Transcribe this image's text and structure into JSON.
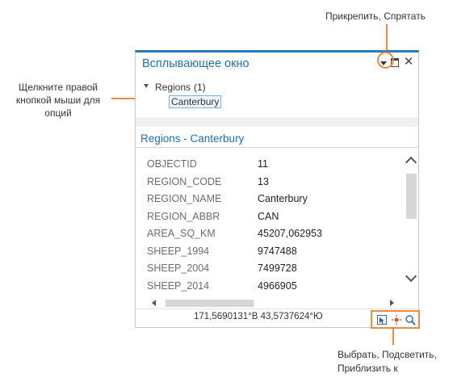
{
  "callouts": {
    "pin_hide": "Прикрепить, Спрятать",
    "right_click_lines": [
      "Щелкните правой",
      "кнопкой мыши для",
      "опций"
    ],
    "tools_lines": [
      "Выбрать, Подсветить,",
      "Приблизить к"
    ]
  },
  "popup": {
    "title": "Всплывающее окно",
    "controls": {
      "dropdown_icon": "chevron-down-icon",
      "maximize_icon": "maximize-icon",
      "close_glyph": "✕"
    },
    "tree": {
      "layer_label": "Regions",
      "layer_count": "(1)",
      "feature_label": "Canterbury"
    },
    "section_title": "Regions - Canterbury",
    "attributes": [
      {
        "key": "OBJECTID",
        "value": "11"
      },
      {
        "key": "REGION_CODE",
        "value": "13"
      },
      {
        "key": "REGION_NAME",
        "value": "Canterbury"
      },
      {
        "key": "REGION_ABBR",
        "value": "CAN"
      },
      {
        "key": "AREA_SQ_KM",
        "value": "45207,062953"
      },
      {
        "key": "SHEEP_1994",
        "value": "9747488"
      },
      {
        "key": "SHEEP_2004",
        "value": "7499728"
      },
      {
        "key": "SHEEP_2014",
        "value": "4966905"
      }
    ],
    "status_bar": {
      "coordinates": "171,5690131°В 43,5737624°Ю",
      "tools": [
        "select-icon",
        "flash-icon",
        "zoom-to-icon"
      ]
    }
  },
  "colors": {
    "accent": "#2e7bb8",
    "title_blue": "#1f6fb0",
    "callout_orange": "#f0883d",
    "selection_border": "#7ab3de"
  }
}
